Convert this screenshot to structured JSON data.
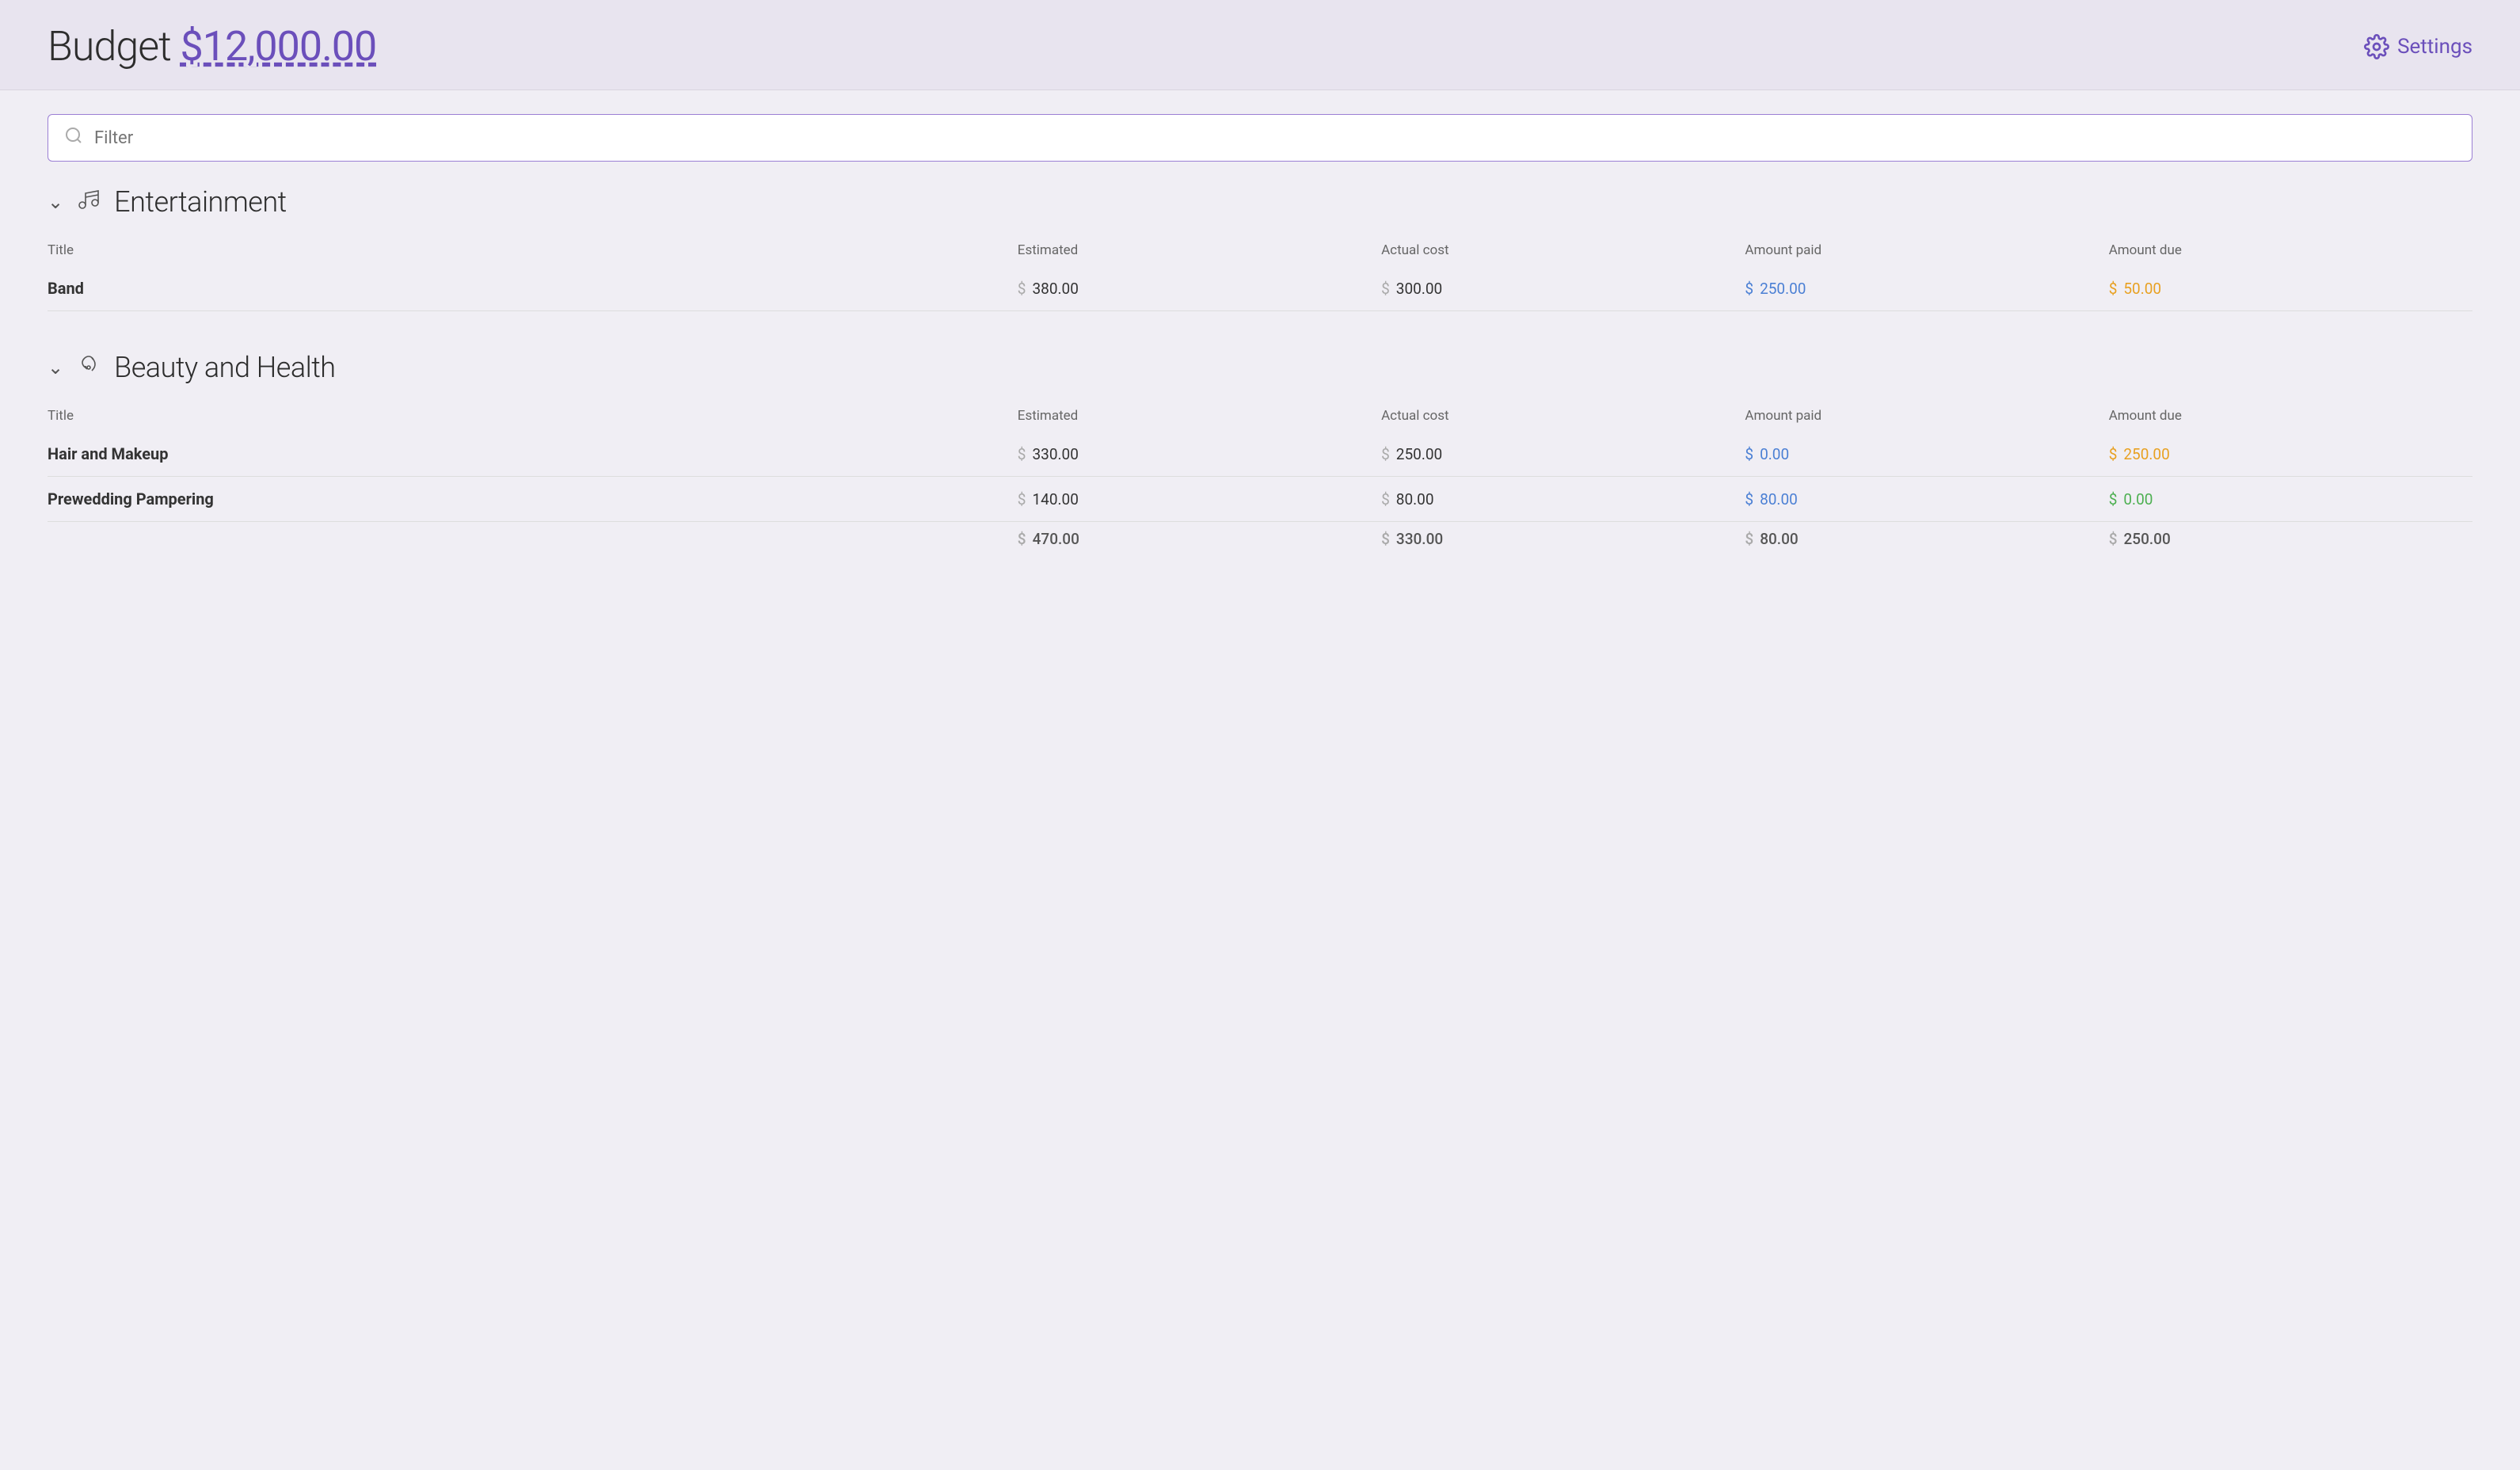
{
  "header": {
    "title_prefix": "Budget",
    "budget_amount": "$12,000.00",
    "settings_label": "Settings"
  },
  "filter": {
    "placeholder": "Filter"
  },
  "categories": [
    {
      "id": "entertainment",
      "name": "Entertainment",
      "icon": "🎵",
      "columns": [
        "Title",
        "Estimated",
        "Actual cost",
        "Amount paid",
        "Amount due"
      ],
      "items": [
        {
          "title": "Band",
          "estimated": "380.00",
          "actual_cost": "300.00",
          "amount_paid": "250.00",
          "amount_due": "50.00",
          "paid_color": "blue",
          "due_color": "orange"
        }
      ],
      "totals": null
    },
    {
      "id": "beauty-and-health",
      "name": "Beauty and Health",
      "icon": "💨",
      "columns": [
        "Title",
        "Estimated",
        "Actual cost",
        "Amount paid",
        "Amount due"
      ],
      "items": [
        {
          "title": "Hair and Makeup",
          "estimated": "330.00",
          "actual_cost": "250.00",
          "amount_paid": "0.00",
          "amount_due": "250.00",
          "paid_color": "blue",
          "due_color": "orange"
        },
        {
          "title": "Prewedding Pampering",
          "estimated": "140.00",
          "actual_cost": "80.00",
          "amount_paid": "80.00",
          "amount_due": "0.00",
          "paid_color": "blue",
          "due_color": "green"
        }
      ],
      "totals": {
        "estimated": "470.00",
        "actual_cost": "330.00",
        "amount_paid": "80.00",
        "amount_due": "250.00"
      }
    }
  ]
}
